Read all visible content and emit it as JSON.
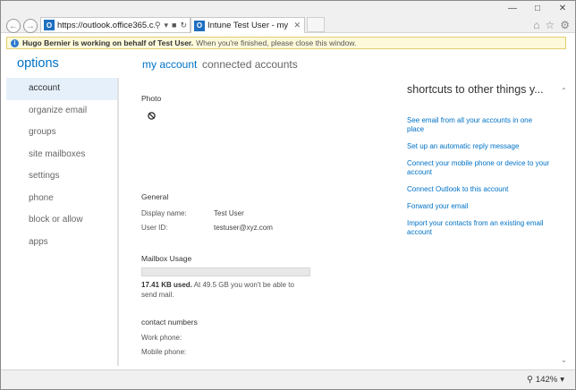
{
  "browser": {
    "address": "https://outlook.office365.c...",
    "tab_title": "Intune Test User - my accoun...",
    "favicon_letter": "O"
  },
  "infobar": {
    "strong": "Hugo Bernier is working on behalf of Test User.",
    "rest": "When you're finished, please close this window."
  },
  "options": {
    "title": "options",
    "sidebar": {
      "items": [
        {
          "label": "account"
        },
        {
          "label": "organize email"
        },
        {
          "label": "groups"
        },
        {
          "label": "site mailboxes"
        },
        {
          "label": "settings"
        },
        {
          "label": "phone"
        },
        {
          "label": "block or allow"
        },
        {
          "label": "apps"
        }
      ]
    },
    "tabs": {
      "my_account": "my account",
      "connected_accounts": "connected accounts"
    }
  },
  "account": {
    "photo_label": "Photo",
    "general_label": "General",
    "display_name_label": "Display name:",
    "display_name_value": "Test User",
    "user_id_label": "User ID:",
    "user_id_value": "testuser@xyz.com",
    "mailbox_usage_label": "Mailbox Usage",
    "usage_strong": "17.41 KB used.",
    "usage_rest": "At 49.5 GB you won't be able to send mail.",
    "usage_fraction": 0.0,
    "contact_numbers_label": "contact numbers",
    "work_phone_label": "Work phone:",
    "mobile_phone_label": "Mobile phone:"
  },
  "shortcuts": {
    "title": "shortcuts to other things y...",
    "links": [
      "See email from all your accounts in one place",
      "Set up an automatic reply message",
      "Connect your mobile phone or device to your account",
      "Connect Outlook to this account",
      "Forward your email",
      "Import your contacts from an existing email account"
    ]
  },
  "status": {
    "zoom": "142%"
  },
  "colors": {
    "accent": "#0072c6",
    "active_bg": "#e6f0fa",
    "infobar_bg": "#fdf9da"
  }
}
